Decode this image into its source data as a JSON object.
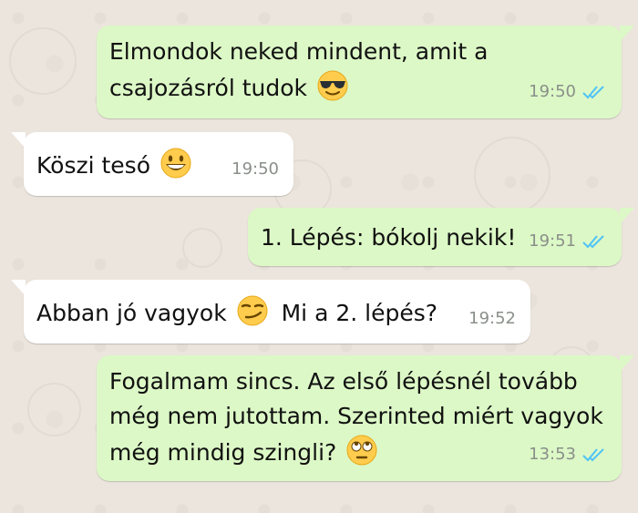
{
  "chat": {
    "background_color": "#ece5dd",
    "outgoing_bubble_color": "#dcf8c6",
    "incoming_bubble_color": "#ffffff",
    "read_tick_color": "#4fc3f7",
    "messages": [
      {
        "direction": "outgoing",
        "lines": [
          "Elmondok neked mindent, amit a",
          "csajozásról tudok"
        ],
        "emoji": "smiling-face-with-sunglasses",
        "time": "19:50",
        "status": "read"
      },
      {
        "direction": "incoming",
        "lines": [
          "Köszi tesó"
        ],
        "emoji": "grinning-face",
        "time": "19:50"
      },
      {
        "direction": "outgoing",
        "lines": [
          "1. Lépés: bókolj nekik!"
        ],
        "time": "19:51",
        "status": "read"
      },
      {
        "direction": "incoming",
        "lines": [
          "Abban jó vagyok",
          "Mi a 2. lépés?"
        ],
        "emoji": "smirking-face",
        "time": "19:52"
      },
      {
        "direction": "outgoing",
        "lines": [
          "Fogalmam sincs. Az első lépésnél tovább",
          "még nem jutottam. Szerinted miért vagyok",
          "még mindig szingli?"
        ],
        "emoji": "face-with-rolling-eyes",
        "time": "13:53",
        "status": "read"
      }
    ]
  }
}
